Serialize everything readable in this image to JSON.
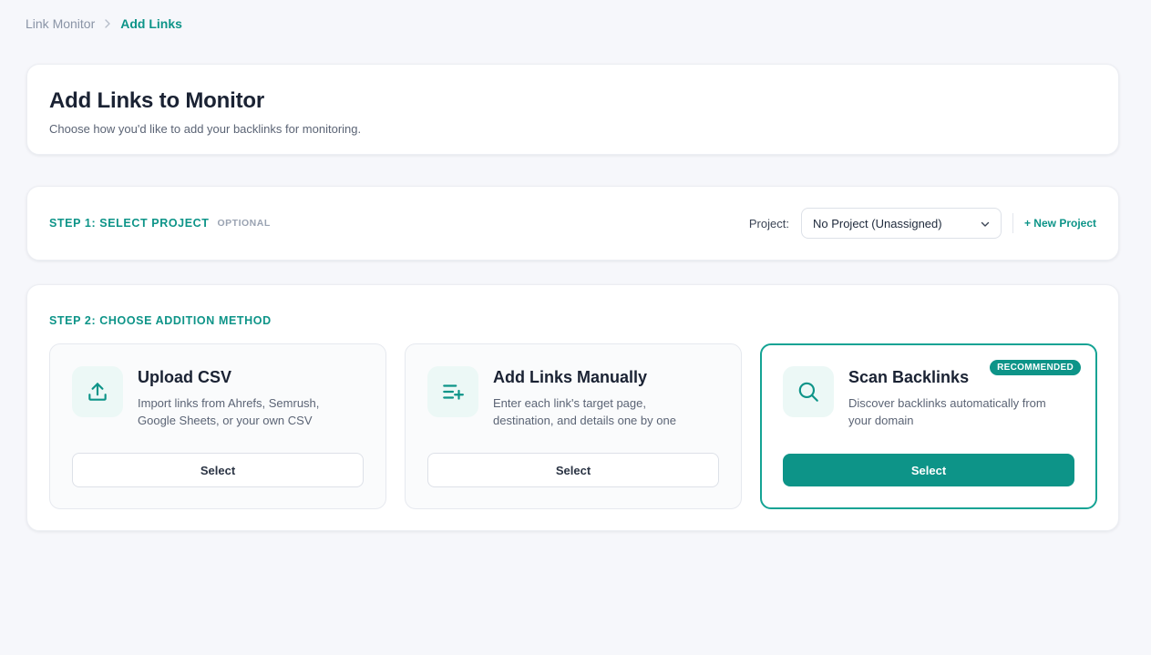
{
  "breadcrumb": {
    "root": "Link Monitor",
    "current": "Add Links"
  },
  "header": {
    "title": "Add Links to Monitor",
    "subtitle": "Choose how you'd like to add your backlinks for monitoring."
  },
  "step1": {
    "label": "STEP 1: SELECT PROJECT",
    "optional": "OPTIONAL",
    "project_label": "Project:",
    "project_value": "No Project (Unassigned)",
    "new_project": "+ New Project"
  },
  "step2": {
    "label": "STEP 2: CHOOSE ADDITION METHOD",
    "methods": [
      {
        "icon": "upload-icon",
        "title": "Upload CSV",
        "description": "Import links from Ahrefs, Semrush, Google Sheets, or your own CSV",
        "button": "Select",
        "selected": false
      },
      {
        "icon": "list-add-icon",
        "title": "Add Links Manually",
        "description": "Enter each link's target page, destination, and details one by one",
        "button": "Select",
        "selected": false
      },
      {
        "icon": "search-icon",
        "title": "Scan Backlinks",
        "description": "Discover backlinks automatically from your domain",
        "button": "Select",
        "badge": "RECOMMENDED",
        "selected": true
      }
    ]
  },
  "colors": {
    "accent": "#0d9488",
    "background": "#f6f7fb",
    "text": "#1a2233",
    "muted": "#5b6475"
  }
}
